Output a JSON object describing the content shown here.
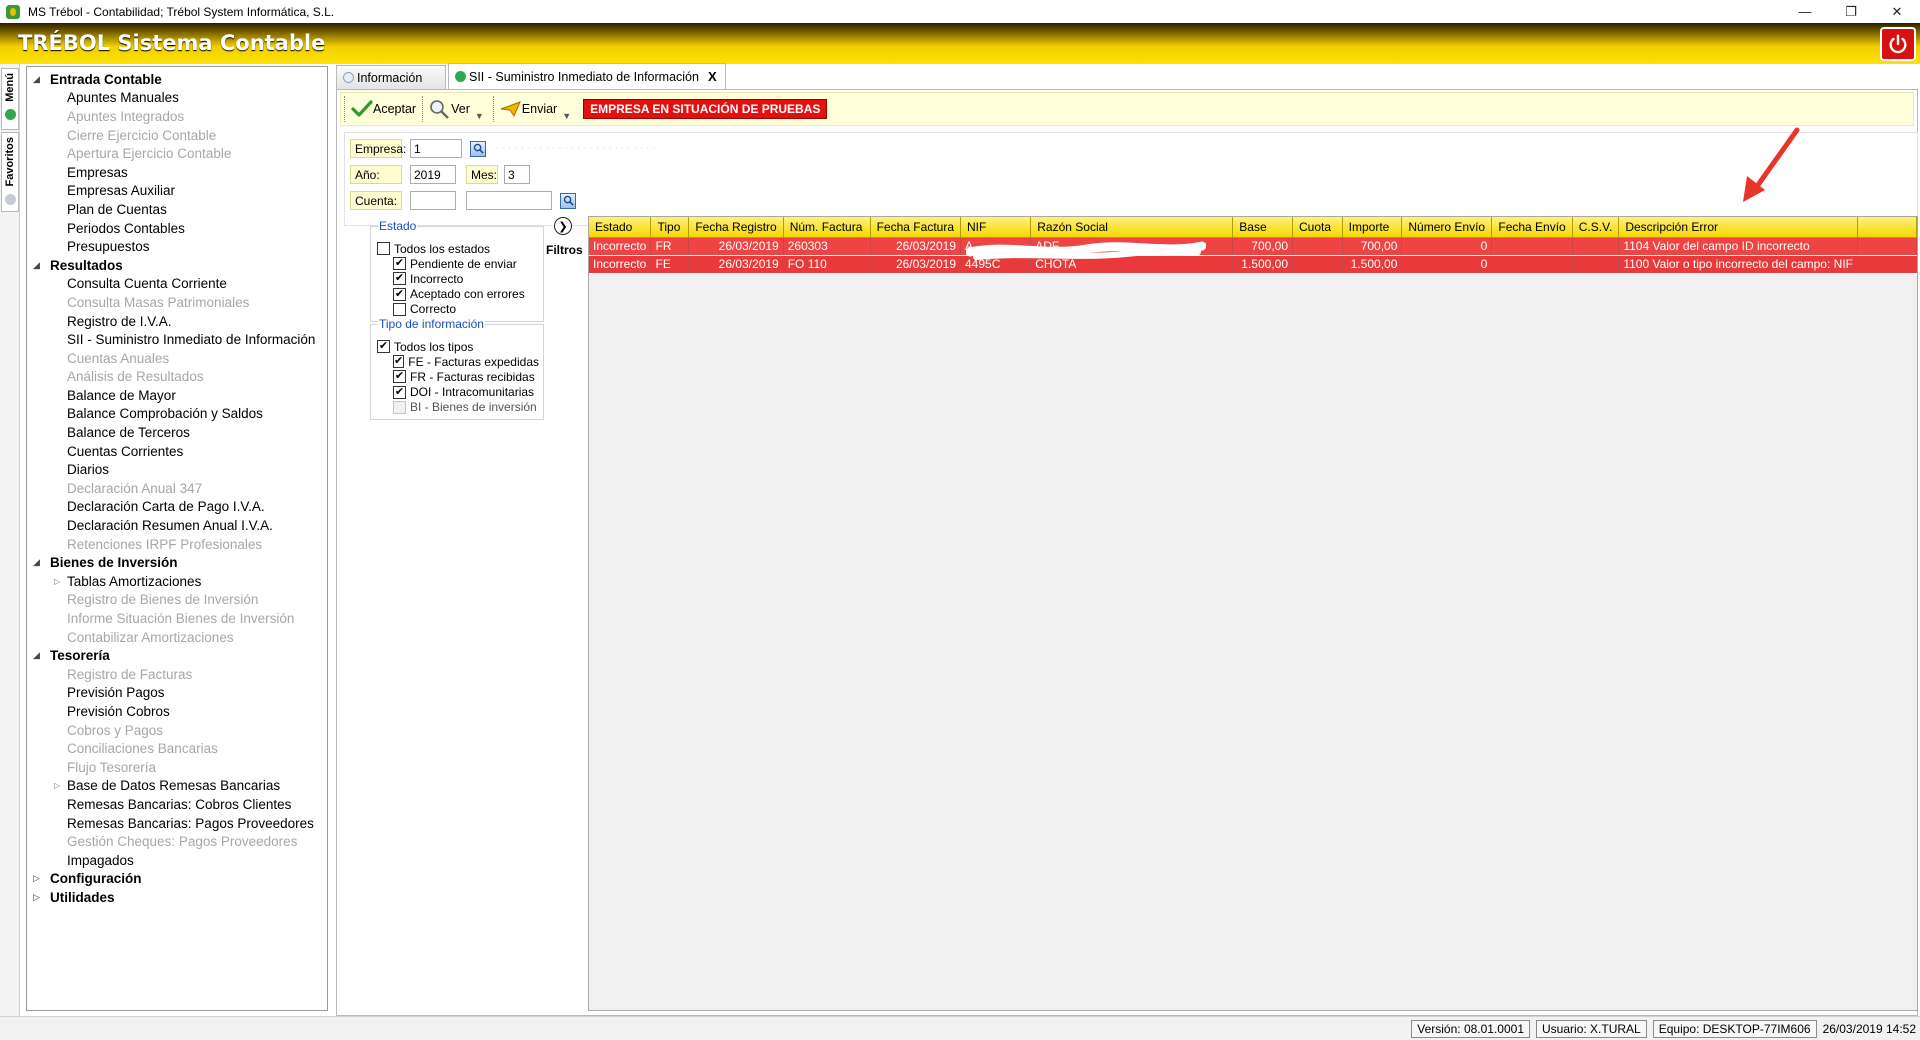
{
  "window": {
    "title": "MS Trébol - Contabilidad; Trébol System Informática, S.L."
  },
  "banner": {
    "brand": "TRÉBOL Sistema Contable"
  },
  "side_tabs": {
    "menu": "Menú",
    "favorites": "Favoritos"
  },
  "sidebar": {
    "sections": [
      {
        "label": "Entrada Contable",
        "items": [
          {
            "label": "Apuntes Manuales",
            "disabled": false
          },
          {
            "label": "Apuntes Integrados",
            "disabled": true
          },
          {
            "label": "Cierre Ejercicio Contable",
            "disabled": true
          },
          {
            "label": "Apertura Ejercicio Contable",
            "disabled": true
          },
          {
            "label": "Empresas",
            "disabled": false
          },
          {
            "label": "Empresas Auxiliar",
            "disabled": false
          },
          {
            "label": "Plan de Cuentas",
            "disabled": false
          },
          {
            "label": "Periodos Contables",
            "disabled": false
          },
          {
            "label": "Presupuestos",
            "disabled": false
          }
        ]
      },
      {
        "label": "Resultados",
        "items": [
          {
            "label": "Consulta Cuenta Corriente",
            "disabled": false
          },
          {
            "label": "Consulta Masas Patrimoniales",
            "disabled": true
          },
          {
            "label": "Registro de I.V.A.",
            "disabled": false
          },
          {
            "label": "SII - Suministro Inmediato de Información",
            "disabled": false
          },
          {
            "label": "Cuentas Anuales",
            "disabled": true
          },
          {
            "label": "Análisis de Resultados",
            "disabled": true
          },
          {
            "label": "Balance de Mayor",
            "disabled": false
          },
          {
            "label": "Balance Comprobación y Saldos",
            "disabled": false
          },
          {
            "label": "Balance de Terceros",
            "disabled": false
          },
          {
            "label": "Cuentas Corrientes",
            "disabled": false
          },
          {
            "label": "Diarios",
            "disabled": false
          },
          {
            "label": "Declaración Anual 347",
            "disabled": true
          },
          {
            "label": "Declaración Carta de Pago I.V.A.",
            "disabled": false
          },
          {
            "label": "Declaración Resumen Anual I.V.A.",
            "disabled": false
          },
          {
            "label": "Retenciones IRPF Profesionales",
            "disabled": true
          }
        ]
      },
      {
        "label": "Bienes de Inversión",
        "items": [
          {
            "label": "Tablas Amortizaciones",
            "disabled": false,
            "expandable": true
          },
          {
            "label": "Registro de Bienes de Inversión",
            "disabled": true
          },
          {
            "label": "Informe Situación Bienes de Inversión",
            "disabled": true
          },
          {
            "label": "Contabilizar Amortizaciones",
            "disabled": true
          }
        ]
      },
      {
        "label": "Tesorería",
        "items": [
          {
            "label": "Registro de Facturas",
            "disabled": true
          },
          {
            "label": "Previsión Pagos",
            "disabled": false
          },
          {
            "label": "Previsión Cobros",
            "disabled": false
          },
          {
            "label": "Cobros y Pagos",
            "disabled": true
          },
          {
            "label": "Conciliaciones Bancarias",
            "disabled": true
          },
          {
            "label": "Flujo Tesorería",
            "disabled": true
          },
          {
            "label": "Base de Datos Remesas Bancarias",
            "disabled": false,
            "expandable": true
          },
          {
            "label": "Remesas Bancarias: Cobros Clientes",
            "disabled": false
          },
          {
            "label": "Remesas Bancarias: Pagos Proveedores",
            "disabled": false
          },
          {
            "label": "Gestión Cheques: Pagos Proveedores",
            "disabled": true
          },
          {
            "label": "Impagados",
            "disabled": false
          }
        ]
      },
      {
        "label": "Configuración",
        "collapsed": true,
        "items": []
      },
      {
        "label": "Utilidades",
        "collapsed": true,
        "items": []
      }
    ]
  },
  "tabs": [
    {
      "label": "Información",
      "active": false
    },
    {
      "label": "SII - Suministro Inmediato de Información",
      "active": true,
      "close": "X"
    }
  ],
  "toolbar": {
    "accept": "Aceptar",
    "view": "Ver",
    "send": "Enviar",
    "warning": "EMPRESA EN SITUACIÓN DE PRUEBAS"
  },
  "filters": {
    "empresa_label": "Empresa:",
    "empresa_value": "1",
    "anio_label": "Año:",
    "anio_value": "2019",
    "mes_label": "Mes:",
    "mes_value": "3",
    "cuenta_label": "Cuenta:",
    "cuenta_value": "",
    "cuenta_desc": ""
  },
  "estado_group": {
    "title": "Estado",
    "all": {
      "label": "Todos los estados",
      "checked": false
    },
    "options": [
      {
        "label": "Pendiente de enviar",
        "checked": true
      },
      {
        "label": "Incorrecto",
        "checked": true
      },
      {
        "label": "Aceptado con errores",
        "checked": true
      },
      {
        "label": "Correcto",
        "checked": false
      }
    ]
  },
  "tipo_group": {
    "title": "Tipo de información",
    "all": {
      "label": "Todos los tipos",
      "checked": true
    },
    "options": [
      {
        "label": "FE - Facturas expedidas",
        "checked": true
      },
      {
        "label": "FR - Facturas recibidas",
        "checked": true
      },
      {
        "label": "DOI - Intracomunitarias",
        "checked": true
      },
      {
        "label": "BI - Bienes de inversión",
        "checked": false,
        "disabled": true
      }
    ]
  },
  "filtros_label": "Filtros",
  "grid": {
    "columns": [
      "Estado",
      "Tipo",
      "Fecha Registro",
      "Núm. Factura",
      "Fecha Factura",
      "NIF",
      "Razón Social",
      "Base",
      "Cuota",
      "Importe",
      "Número Envío",
      "Fecha Envío",
      "C.S.V.",
      "Descripción Error"
    ],
    "rows": [
      [
        "Incorrecto",
        "FR",
        "26/03/2019",
        "260303",
        "26/03/2019",
        "A",
        "ADF",
        "700,00",
        "",
        "700,00",
        "0",
        "",
        "",
        "1104 Valor del campo ID incorrecto"
      ],
      [
        "Incorrecto",
        "FE",
        "26/03/2019",
        "FO 110",
        "26/03/2019",
        "4495C",
        "CHOTA",
        "1.500,00",
        "",
        "1.500,00",
        "0",
        "",
        "",
        "1100 Valor o tipo incorrecto del campo: NIF"
      ]
    ]
  },
  "colors": {
    "accent": "#f6d700",
    "error_row": "#ee4444",
    "warning": "#e41010",
    "annotation": "#e8342a"
  },
  "statusbar": {
    "version": "Versión: 08.01.0001",
    "user": "Usuario: X.TURAL",
    "machine": "Equipo: DESKTOP-77IM606",
    "datetime": "26/03/2019  14:52"
  }
}
